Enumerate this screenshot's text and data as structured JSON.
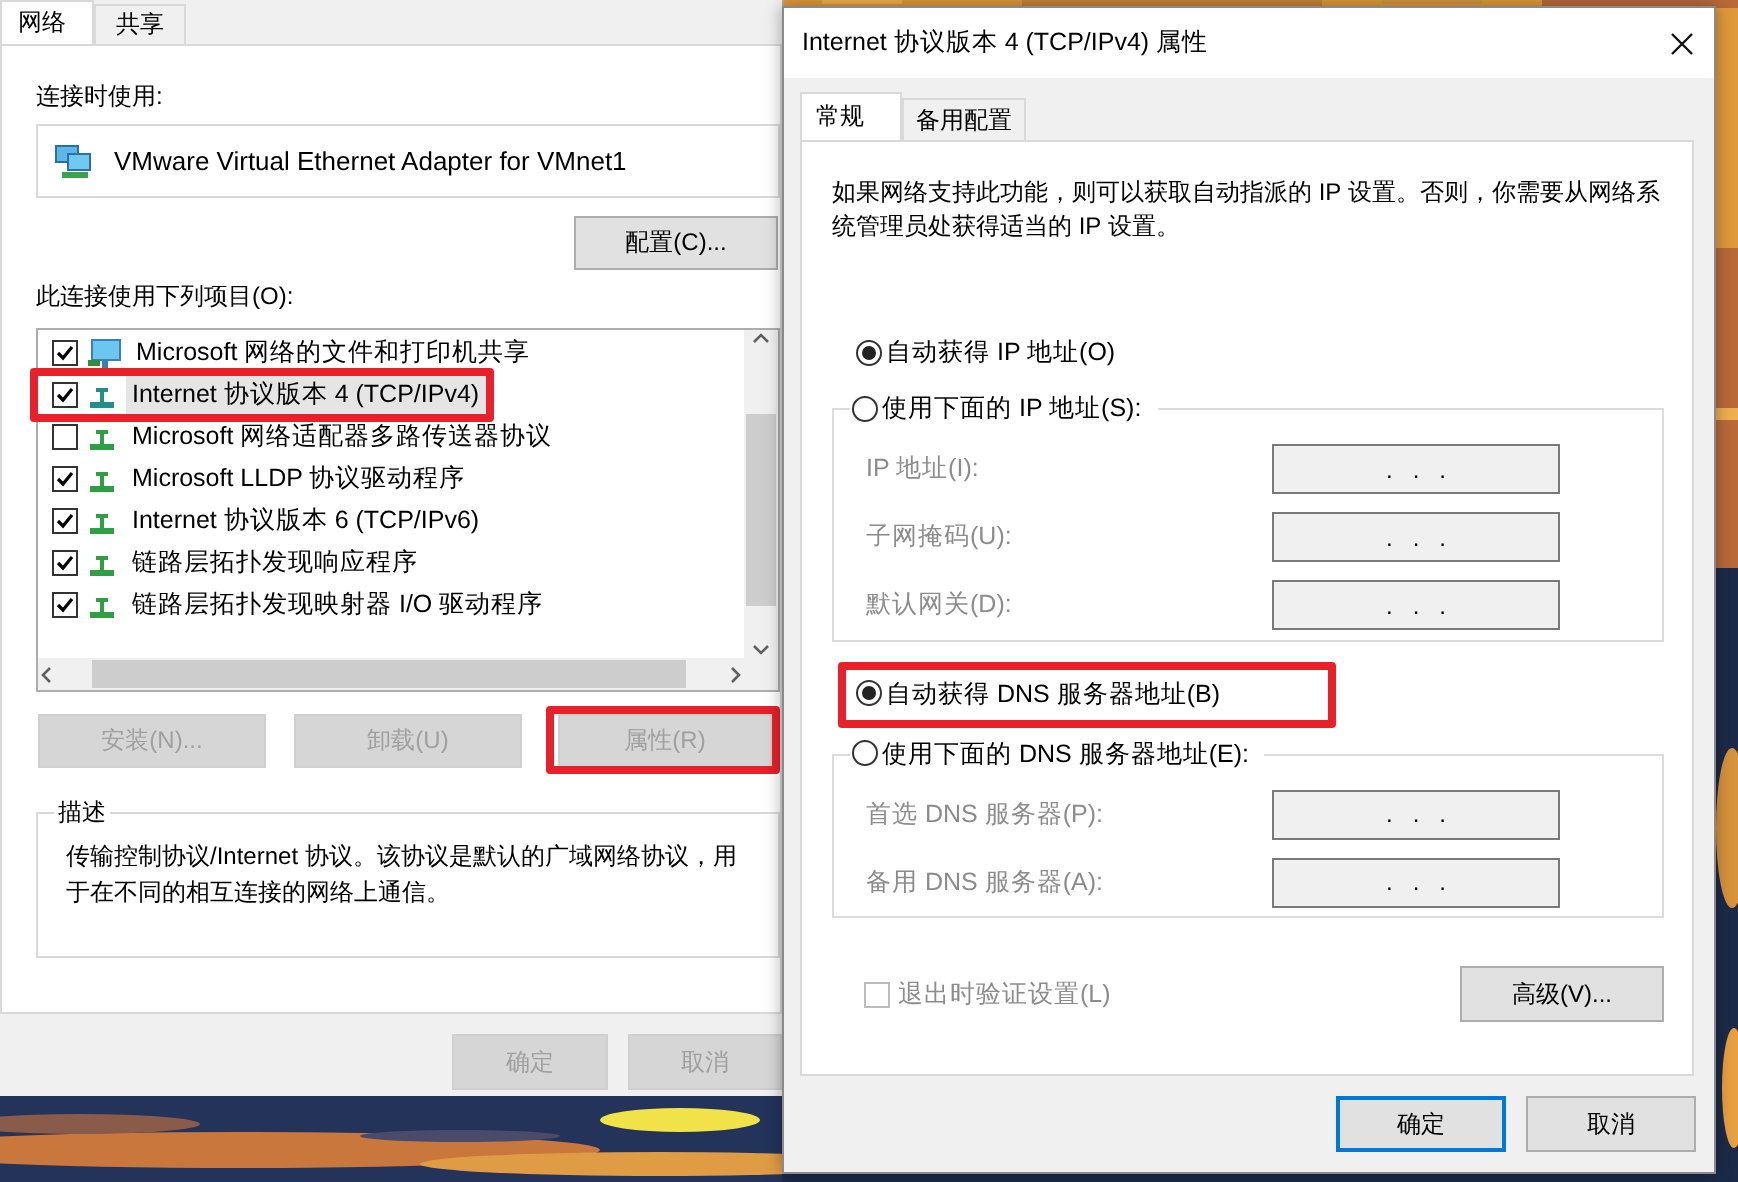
{
  "left_window": {
    "tabs": [
      {
        "label": "网络",
        "selected": true
      },
      {
        "label": "共享",
        "selected": false
      }
    ],
    "connect_using_label": "连接时使用:",
    "adapter": "VMware Virtual Ethernet Adapter for VMnet1",
    "configure_button": "配置(C)...",
    "items_label": "此连接使用下列项目(O):",
    "items": [
      {
        "label": "Microsoft 网络的文件和打印机共享",
        "kind": "service",
        "checked": true,
        "selected": false,
        "highlighted": false
      },
      {
        "label": "Internet 协议版本 4 (TCP/IPv4)",
        "kind": "protocol",
        "checked": true,
        "selected": true,
        "highlighted": true
      },
      {
        "label": "Microsoft 网络适配器多路传送器协议",
        "kind": "protocol",
        "checked": false,
        "selected": false,
        "highlighted": false
      },
      {
        "label": "Microsoft LLDP 协议驱动程序",
        "kind": "protocol",
        "checked": true,
        "selected": false,
        "highlighted": false
      },
      {
        "label": "Internet 协议版本 6 (TCP/IPv6)",
        "kind": "protocol",
        "checked": true,
        "selected": false,
        "highlighted": false
      },
      {
        "label": "链路层拓扑发现响应程序",
        "kind": "protocol",
        "checked": true,
        "selected": false,
        "highlighted": false
      },
      {
        "label": "链路层拓扑发现映射器 I/O 驱动程序",
        "kind": "protocol",
        "checked": true,
        "selected": false,
        "highlighted": false
      }
    ],
    "buttons": [
      {
        "label": "安装(N)...",
        "disabled": true,
        "highlighted": false
      },
      {
        "label": "卸载(U)",
        "disabled": true,
        "highlighted": false
      },
      {
        "label": "属性(R)",
        "disabled": true,
        "highlighted": true
      }
    ],
    "description": {
      "title": "描述",
      "text": "传输控制协议/Internet 协议。该协议是默认的广域网络协议，用于在不同的相互连接的网络上通信。"
    },
    "footer_buttons": [
      {
        "label": "确定",
        "disabled": true
      },
      {
        "label": "取消",
        "disabled": true
      }
    ]
  },
  "dialog": {
    "title": "Internet 协议版本 4 (TCP/IPv4) 属性",
    "tabs": [
      {
        "label": "常规",
        "selected": true
      },
      {
        "label": "备用配置",
        "selected": false
      }
    ],
    "intro": "如果网络支持此功能，则可以获取自动指派的 IP 设置。否则，你需要从网络系统管理员处获得适当的 IP 设置。",
    "ip_mode": [
      {
        "label": "自动获得 IP 地址(O)",
        "selected": true,
        "highlighted": false
      },
      {
        "label": "使用下面的 IP 地址(S):",
        "selected": false,
        "highlighted": false
      }
    ],
    "ip_fields": [
      {
        "label": "IP 地址(I):",
        "value": ".   .   .",
        "disabled": true
      },
      {
        "label": "子网掩码(U):",
        "value": ".   .   .",
        "disabled": true
      },
      {
        "label": "默认网关(D):",
        "value": ".   .   .",
        "disabled": true
      }
    ],
    "dns_mode": [
      {
        "label": "自动获得 DNS 服务器地址(B)",
        "selected": true,
        "highlighted": true
      },
      {
        "label": "使用下面的 DNS 服务器地址(E):",
        "selected": false,
        "highlighted": false
      }
    ],
    "dns_fields": [
      {
        "label": "首选 DNS 服务器(P):",
        "value": ".   .   .",
        "disabled": true
      },
      {
        "label": "备用 DNS 服务器(A):",
        "value": ".   .   .",
        "disabled": true
      }
    ],
    "validate_checkbox": {
      "label": "退出时验证设置(L)",
      "checked": false,
      "disabled": true
    },
    "advanced_button": "高级(V)...",
    "buttons": [
      {
        "label": "确定",
        "focused": true
      },
      {
        "label": "取消",
        "focused": false
      }
    ]
  }
}
